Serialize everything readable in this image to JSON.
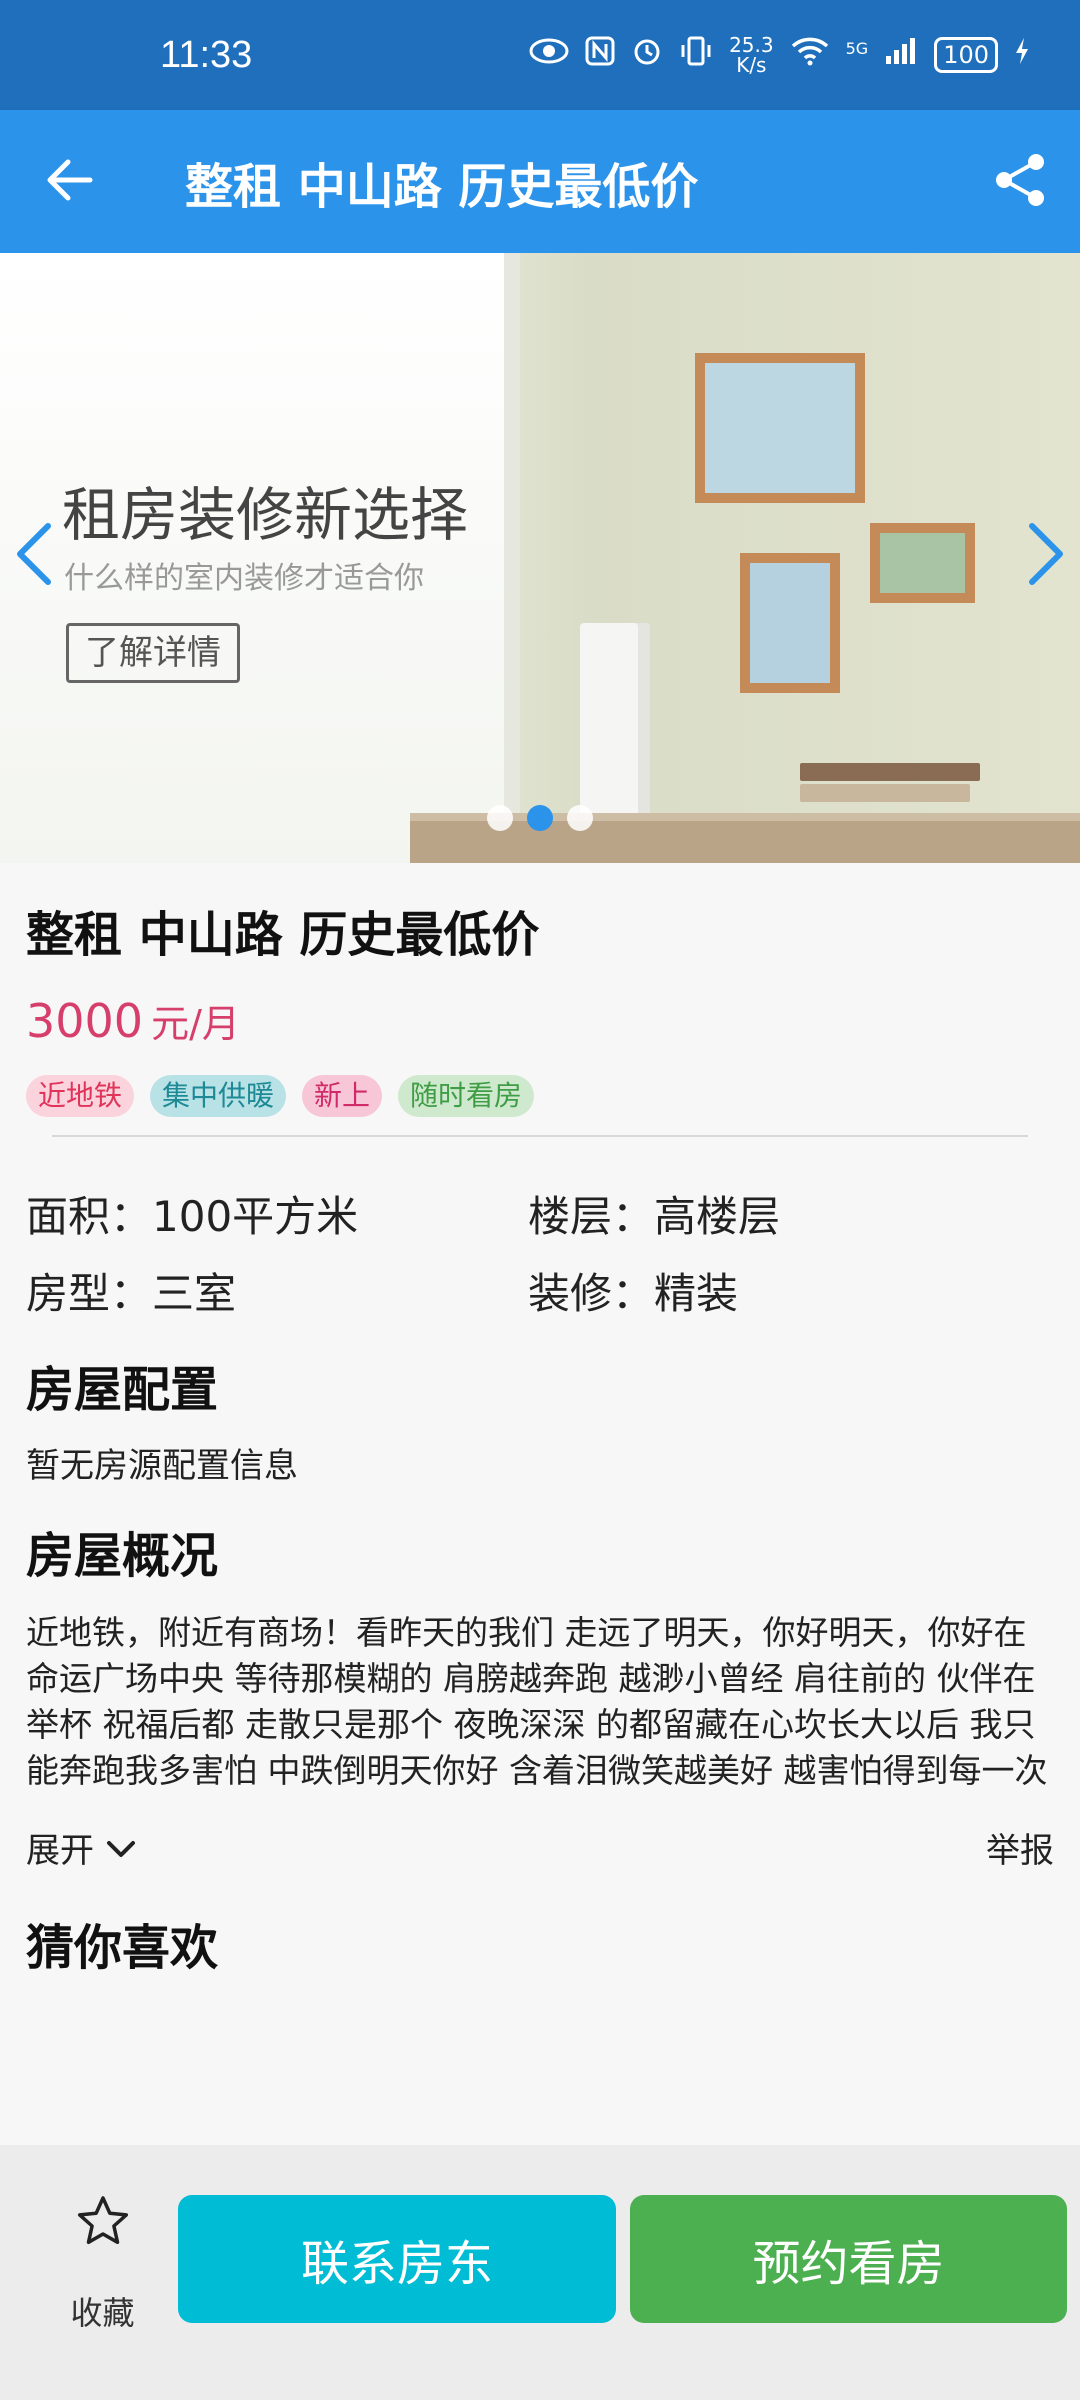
{
  "status_bar": {
    "time": "11:33",
    "net_speed_value": "25.3",
    "net_speed_unit": "K/s",
    "network_label": "5G",
    "battery": "100",
    "icons": [
      "eye-icon",
      "nfc-icon",
      "alarm-icon",
      "vibrate-icon",
      "wifi-icon",
      "signal-icon",
      "battery-icon",
      "charging-icon"
    ]
  },
  "app_bar": {
    "title": "整租 中山路 历史最低价",
    "back_icon": "arrow-left-icon",
    "share_icon": "share-icon"
  },
  "banner": {
    "headline": "租房装修新选择",
    "subline": "什么样的室内装修才适合你",
    "cta": "了解详情",
    "slide_count": 3,
    "active_slide": 2
  },
  "listing": {
    "title": "整租 中山路 历史最低价",
    "price": "3000",
    "price_unit": "元/月",
    "tags": [
      {
        "label": "近地铁",
        "bg": "#fbd3dc",
        "color": "#e0345a"
      },
      {
        "label": "集中供暖",
        "bg": "#b9e2e6",
        "color": "#1d8a96"
      },
      {
        "label": "新上",
        "bg": "#f8c7d7",
        "color": "#d02b68"
      },
      {
        "label": "随时看房",
        "bg": "#cfe9cf",
        "color": "#3f9d45"
      }
    ],
    "specs": {
      "area_label": "面积：",
      "area_value": "100平方米",
      "floor_label": "楼层：",
      "floor_value": "高楼层",
      "layout_label": "房型：",
      "layout_value": "三室",
      "decoration_label": "装修：",
      "decoration_value": "精装"
    }
  },
  "sections": {
    "config_title": "房屋配置",
    "config_empty": "暂无房源配置信息",
    "overview_title": "房屋概况",
    "overview_text": "近地铁，附近有商场！看昨天的我们 走远了明天，你好明天，你好在命运广场中央 等待那模糊的 肩膀越奔跑 越渺小曾经 肩往前的 伙伴在举杯 祝福后都 走散只是那个 夜晚深深 的都留藏在心坎长大以后 我只能奔跑我多害怕 中跌倒明天你好 含着泪微笑越美好 越害怕得到每一次哭又笑着 奔跑一边失去 一边在寻找明天你",
    "expand_label": "展开",
    "report_label": "举报",
    "recommend_title": "猜你喜欢"
  },
  "bottom_bar": {
    "favorite_label": "收藏",
    "contact_label": "联系房东",
    "contact_color": "#00bcd4",
    "appointment_label": "预约看房",
    "appointment_color": "#4caf50"
  },
  "colors": {
    "status_bar": "#1f6fbd",
    "app_bar": "#2b93ea",
    "price": "#d63f6b"
  }
}
